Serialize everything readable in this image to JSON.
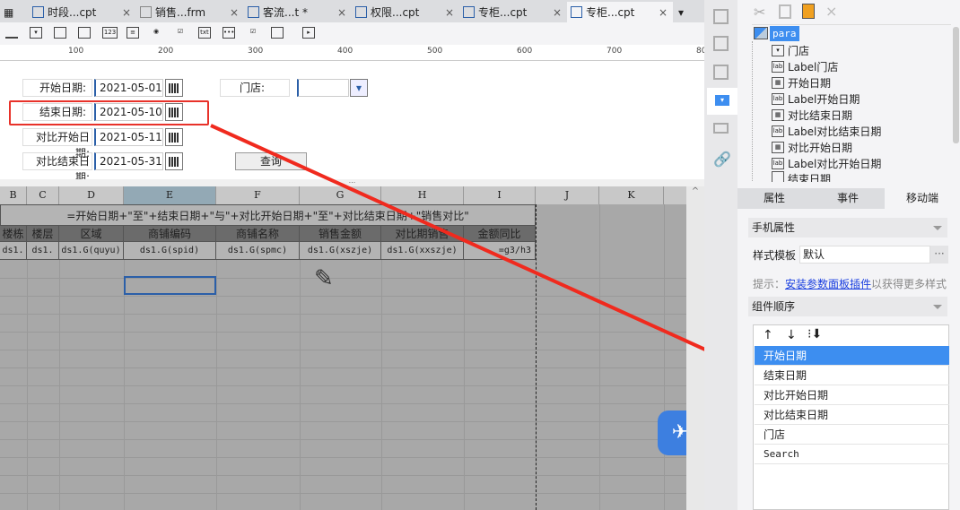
{
  "tabs": [
    {
      "label": "时段...cpt"
    },
    {
      "label": "销售...frm"
    },
    {
      "label": "客流...t *"
    },
    {
      "label": "权限...cpt"
    },
    {
      "label": "专柜...cpt"
    },
    {
      "label": "专柜...cpt",
      "active": true
    }
  ],
  "toolbar": {
    "text_icon": "txt",
    "number_icon": "123"
  },
  "ruler": [
    "100",
    "200",
    "300",
    "400",
    "500",
    "600",
    "700",
    "80"
  ],
  "params": {
    "start_label": "开始日期:",
    "start_value": "2021-05-01",
    "end_label": "结束日期:",
    "end_value": "2021-05-10",
    "cmp_start_label": "对比开始日期:",
    "cmp_start_value": "2021-05-11",
    "cmp_end_label": "对比结束日期:",
    "cmp_end_value": "2021-05-31",
    "store_label": "门店:",
    "store_value": "",
    "query_button": "查询",
    "splitter": "..."
  },
  "sheet": {
    "columns": [
      "B",
      "C",
      "D",
      "E",
      "F",
      "G",
      "H",
      "I",
      "J",
      "K"
    ],
    "title_formula": "=开始日期+\"至\"+结束日期+\"与\"+对比开始日期+\"至\"+对比结束日期+\"销售对比\"",
    "headers": [
      "楼栋",
      "楼层",
      "区域",
      "商铺编码",
      "商铺名称",
      "销售金额",
      "对比期销售",
      "金额同比"
    ],
    "row": [
      "ds1.",
      "ds1.",
      "ds1.G(quyu)",
      "ds1.G(spid)",
      "ds1.G(spmc)",
      "ds1.G(xszje)",
      "ds1.G(xxszje)",
      "=g3/h3"
    ]
  },
  "right_panel": {
    "tree_root": "para",
    "tree": [
      {
        "label": "门店",
        "icon": "combo"
      },
      {
        "label": "Label门店",
        "icon": "label"
      },
      {
        "label": "开始日期",
        "icon": "date"
      },
      {
        "label": "Label开始日期",
        "icon": "label"
      },
      {
        "label": "对比结束日期",
        "icon": "date"
      },
      {
        "label": "Label对比结束日期",
        "icon": "label"
      },
      {
        "label": "对比开始日期",
        "icon": "date"
      },
      {
        "label": "Label对比开始日期",
        "icon": "label"
      },
      {
        "label": "结束日期",
        "icon": "date"
      }
    ],
    "tabs": [
      "属性",
      "事件",
      "移动端"
    ],
    "mobile_props": "手机属性",
    "style_template_label": "样式模板",
    "style_template_value": "默认",
    "more_button": "···",
    "hint_prefix": "提示：",
    "hint_link": "安装参数面板插件",
    "hint_suffix": "以获得更多样式",
    "order_section": "组件顺序",
    "order_items": [
      "开始日期",
      "结束日期",
      "对比开始日期",
      "对比结束日期",
      "门店",
      "Search"
    ],
    "selected_index": 0
  },
  "colors": {
    "accent": "#3d8ef0",
    "highlight_box": "#e8322a",
    "header_dark": "#6b6b6b"
  }
}
